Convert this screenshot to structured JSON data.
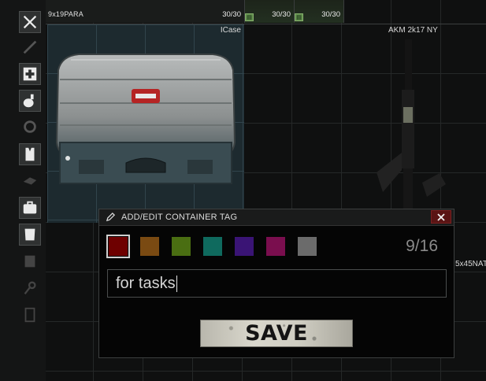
{
  "sidebar": {
    "categories": [
      {
        "icon": "tools-icon",
        "dim": false
      },
      {
        "icon": "melee-icon",
        "dim": true
      },
      {
        "icon": "medical-icon",
        "dim": false
      },
      {
        "icon": "grenade-icon",
        "dim": false
      },
      {
        "icon": "barter-icon",
        "dim": true
      },
      {
        "icon": "rig-icon",
        "dim": false
      },
      {
        "icon": "mods-icon",
        "dim": true
      },
      {
        "icon": "containers-icon",
        "dim": false
      },
      {
        "icon": "armor-icon",
        "dim": false
      },
      {
        "icon": "info-icon",
        "dim": true
      },
      {
        "icon": "keys-icon",
        "dim": true
      },
      {
        "icon": "special-icon",
        "dim": true
      }
    ]
  },
  "stash": {
    "ammo_row": [
      {
        "label": "9x19PARA",
        "count": "30/30"
      },
      {
        "label": "",
        "count": "30/30"
      },
      {
        "label": "",
        "count": "30/30"
      }
    ],
    "icase_label": "ICase",
    "akm_label": "AKM 2k17 NY",
    "ammo_right_label": "5x45NAT"
  },
  "dialog": {
    "title": "ADD/EDIT CONTAINER TAG",
    "swatches": [
      "#6e0000",
      "#7a4a12",
      "#4a6e12",
      "#0f6a5e",
      "#3a1475",
      "#7a0e4e",
      "#6b6b6b"
    ],
    "selected_swatch": 0,
    "counter": "9/16",
    "input_value": "for tasks",
    "save_label": "SAVE"
  }
}
